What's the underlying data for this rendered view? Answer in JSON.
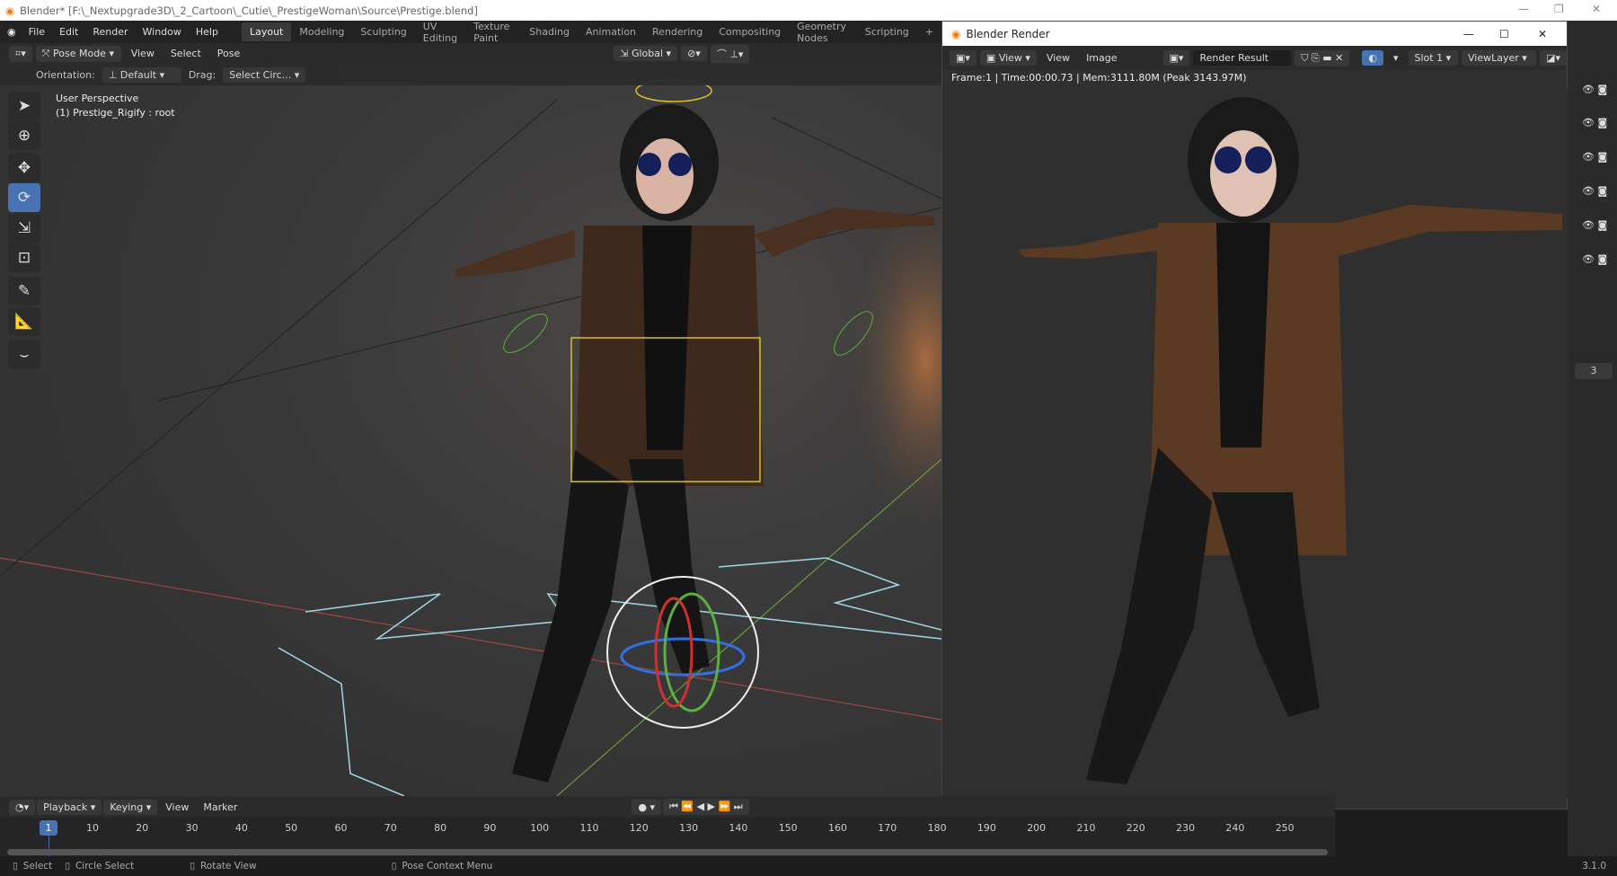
{
  "window": {
    "title": "Blender* [F:\\_Nextupgrade3D\\_2_Cartoon\\_Cutie\\_PrestigeWoman\\Source\\Prestige.blend]"
  },
  "menu": [
    "File",
    "Edit",
    "Render",
    "Window",
    "Help"
  ],
  "workspaces": [
    "Layout",
    "Modeling",
    "Sculpting",
    "UV Editing",
    "Texture Paint",
    "Shading",
    "Animation",
    "Rendering",
    "Compositing",
    "Geometry Nodes",
    "Scripting",
    "+"
  ],
  "active_workspace": "Layout",
  "header": {
    "mode": "Pose Mode",
    "menus": [
      "View",
      "Select",
      "Pose"
    ],
    "transform": "Global"
  },
  "toolsettings": {
    "orientation_label": "Orientation:",
    "orientation": "Default",
    "drag_label": "Drag:",
    "drag": "Select Circ..."
  },
  "viewport": {
    "line1": "User Perspective",
    "line2": "(1) Prestige_Rigify : root"
  },
  "tools": [
    "select-box-icon",
    "cursor-icon",
    "move-icon",
    "rotate-icon",
    "scale-icon",
    "transform-icon",
    "annotate-icon",
    "measure-icon",
    "curve-icon"
  ],
  "active_tool": "rotate-icon",
  "render_window": {
    "title": "Blender Render",
    "view_menu": "View",
    "menus": [
      "View",
      "Image"
    ],
    "image": "Render Result",
    "slot": "Slot 1",
    "layer": "ViewLayer",
    "info": "Frame:1 | Time:00:00.73 | Mem:3111.80M (Peak 3143.97M)"
  },
  "timeline": {
    "menus": [
      "Playback",
      "Keying",
      "View",
      "Marker"
    ],
    "current_frame": "1",
    "frames": [
      "10",
      "20",
      "30",
      "40",
      "50",
      "60",
      "70",
      "80",
      "90",
      "100",
      "110",
      "120",
      "130",
      "140",
      "150",
      "160",
      "170",
      "180",
      "190",
      "200",
      "210",
      "220",
      "230",
      "240",
      "250"
    ]
  },
  "right_panel": {
    "value": "3"
  },
  "status": {
    "select": "Select",
    "circle_select": "Circle Select",
    "rotate": "Rotate View",
    "context": "Pose Context Menu",
    "version": "3.1.0"
  },
  "colors": {
    "accent": "#4772b3",
    "rig_yellow": "#d8c030",
    "rig_green": "#5ab040",
    "rig_red": "#d03030",
    "rig_cyan": "#a0d8e8"
  }
}
